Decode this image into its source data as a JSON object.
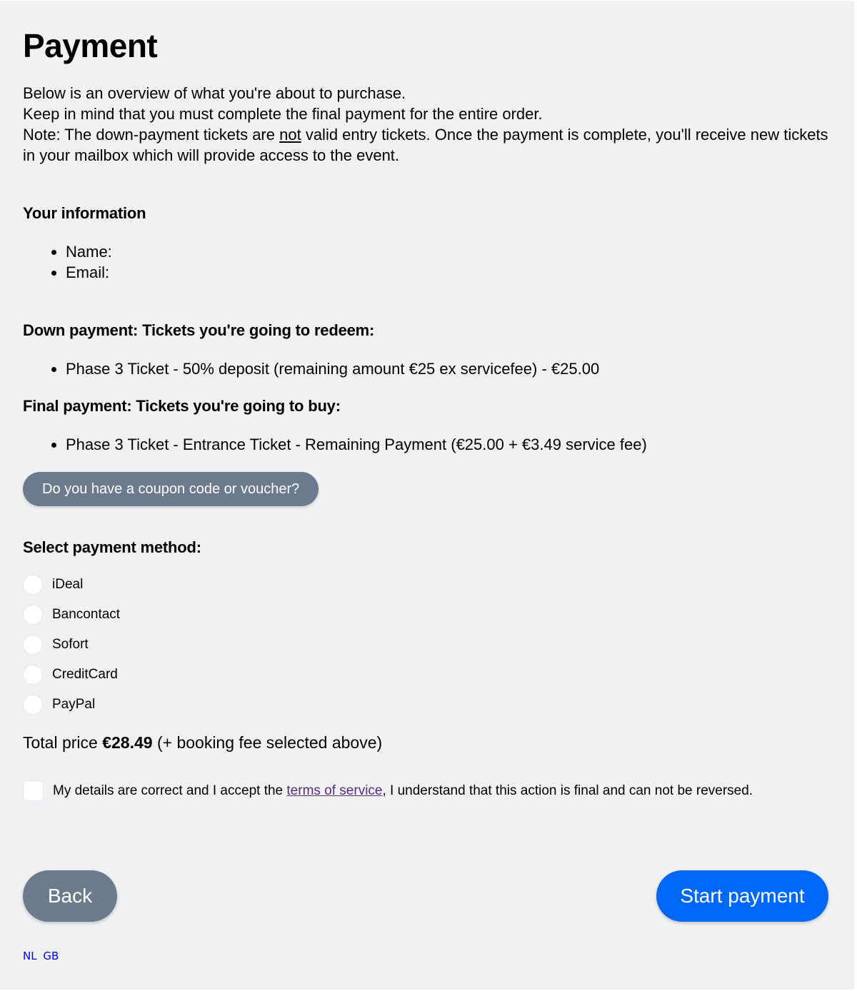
{
  "page": {
    "title": "Payment",
    "intro": {
      "line1": "Below is an overview of what you're about to purchase.",
      "line2": "Keep in mind that you must complete the final payment for the entire order.",
      "line3_before": "Note: The down-payment tickets are ",
      "line3_emph": "not",
      "line3_after": " valid entry tickets. Once the payment is complete, you'll receive new tickets in your mailbox which will provide access to the event."
    }
  },
  "your_information": {
    "heading": "Your information",
    "items": [
      {
        "label": "Name:",
        "value": ""
      },
      {
        "label": "Email:",
        "value": ""
      }
    ]
  },
  "down_payment": {
    "heading": "Down payment: Tickets you're going to redeem:",
    "items": [
      "Phase 3 Ticket - 50% deposit (remaining amount €25 ex servicefee) - €25.00"
    ]
  },
  "final_payment": {
    "heading": "Final payment: Tickets you're going to buy:",
    "items": [
      "Phase 3 Ticket - Entrance Ticket - Remaining Payment (€25.00 + €3.49 service fee)"
    ]
  },
  "coupon": {
    "button_label": "Do you have a coupon code or voucher?"
  },
  "payment_method": {
    "heading": "Select payment method:",
    "options": [
      {
        "label": "iDeal",
        "selected": false
      },
      {
        "label": "Bancontact",
        "selected": false
      },
      {
        "label": "Sofort",
        "selected": false
      },
      {
        "label": "CreditCard",
        "selected": false
      },
      {
        "label": "PayPal",
        "selected": false
      }
    ]
  },
  "total": {
    "prefix": "Total price ",
    "amount": "€28.49",
    "suffix": " (+ booking fee selected above)"
  },
  "terms": {
    "checked": false,
    "before": "My details are correct and I accept the ",
    "link": "terms of service",
    "after": ", I understand that this action is final and can not be reversed."
  },
  "actions": {
    "back_label": "Back",
    "start_label": "Start payment"
  },
  "languages": [
    "NL",
    "GB"
  ],
  "colors": {
    "background": "#f0f1f3",
    "primary": "#0068f8",
    "secondary": "#6c7a8d",
    "link_visited": "#5b2a86",
    "lang_link": "#0000ee"
  }
}
